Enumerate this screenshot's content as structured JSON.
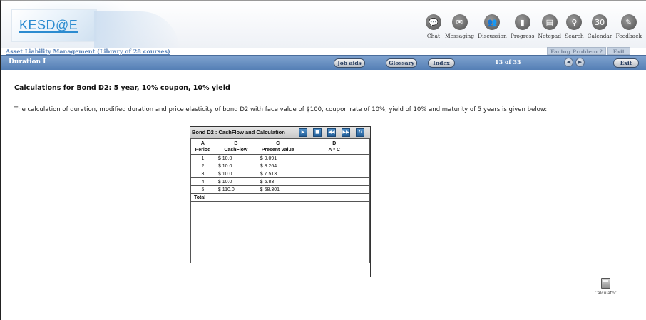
{
  "header": {
    "logo_text": "KESD@E",
    "tools": [
      {
        "label": "Chat",
        "icon": "chat-icon",
        "glyph": "💬"
      },
      {
        "label": "Messaging",
        "icon": "envelope-icon",
        "glyph": "✉"
      },
      {
        "label": "Discussion",
        "icon": "people-icon",
        "glyph": "👥"
      },
      {
        "label": "Progress",
        "icon": "bar-chart-icon",
        "glyph": "▮"
      },
      {
        "label": "Notepad",
        "icon": "notepad-icon",
        "glyph": "▤"
      },
      {
        "label": "Search",
        "icon": "search-icon",
        "glyph": "⚲"
      },
      {
        "label": "Calendar",
        "icon": "calendar-icon",
        "glyph": "30"
      },
      {
        "label": "Feedback",
        "icon": "feedback-icon",
        "glyph": "✎"
      }
    ]
  },
  "course_bar": {
    "title": "Asset Liability Management (Library of 28 courses)",
    "facing_problem": "Facing Problem ?",
    "exit": "Exit"
  },
  "nav": {
    "module_title": "Duration I",
    "job_aids": "Job aids",
    "glossary": "Glossary",
    "index": "Index",
    "page_count": "13 of 33",
    "prev_icon": "arrow-left-icon",
    "next_icon": "arrow-right-icon",
    "exit": "Exit"
  },
  "content": {
    "heading": "Calculations for Bond D2: 5 year, 10% coupon, 10% yield",
    "description": "The calculation of duration, modified duration and price elasticity of bond D2 with face value of $100, coupon rate of 10%, yield of 10% and maturity of 5 years is given below:"
  },
  "table": {
    "title": "Bond D2 : CashFlow and Calculation",
    "buttons": [
      {
        "name": "play-icon",
        "glyph": "▶"
      },
      {
        "name": "stop-icon",
        "glyph": "■"
      },
      {
        "name": "rewind-icon",
        "glyph": "◀◀"
      },
      {
        "name": "fast-forward-icon",
        "glyph": "▶▶"
      },
      {
        "name": "refresh-icon",
        "glyph": "↻"
      }
    ],
    "columns": [
      {
        "letter": "A",
        "label": "Period"
      },
      {
        "letter": "B",
        "label": "CashFlow"
      },
      {
        "letter": "C",
        "label": "Present Value"
      },
      {
        "letter": "D",
        "label": "A * C"
      }
    ],
    "rows": [
      [
        "1",
        "$ 10.0",
        "$ 9.091",
        ""
      ],
      [
        "2",
        "$ 10.0",
        "$ 8.264",
        ""
      ],
      [
        "3",
        "$ 10.0",
        "$ 7.513",
        ""
      ],
      [
        "4",
        "$ 10.0",
        "$ 6.83",
        ""
      ],
      [
        "5",
        "$ 110.0",
        "$ 68.301",
        ""
      ]
    ],
    "total_label": "Total"
  },
  "calculator": {
    "label": "Calculator",
    "icon": "calculator-icon"
  }
}
